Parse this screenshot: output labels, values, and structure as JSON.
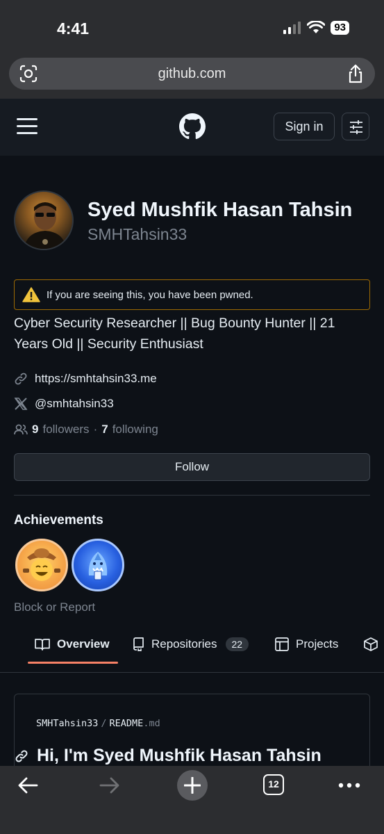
{
  "status_bar": {
    "time": "4:41",
    "battery": "93"
  },
  "browser": {
    "url": "github.com",
    "tabs_count": "12"
  },
  "header": {
    "sign_in_label": "Sign in"
  },
  "profile": {
    "full_name": "Syed Mushfik Hasan Tahsin",
    "username": "SMHTahsin33",
    "warning": "If you are seeing this, you have been pwned.",
    "bio": "Cyber Security Researcher || Bug Bounty Hunter || 21 Years Old || Security Enthusiast",
    "website": "https://smhtahsin33.me",
    "x_handle": "@smhtahsin33",
    "followers_count": "9",
    "followers_label": "followers",
    "separator": "·",
    "following_count": "7",
    "following_label": "following",
    "follow_button": "Follow",
    "achievements_title": "Achievements",
    "block_report": "Block or Report"
  },
  "tabs": [
    {
      "label": "Overview",
      "icon": "book-icon"
    },
    {
      "label": "Repositories",
      "icon": "repo-icon",
      "count": "22"
    },
    {
      "label": "Projects",
      "icon": "table-icon"
    },
    {
      "label": "",
      "icon": "package-icon"
    }
  ],
  "readme": {
    "owner": "SMHTahsin33",
    "slash": "/",
    "file": "README",
    "ext": ".md",
    "heading": "Hi, I'm Syed Mushfik Hasan Tahsin"
  },
  "colors": {
    "background": "#0d1117",
    "header": "#161b22",
    "border": "#30363d",
    "muted": "#7d8590",
    "warning_border": "#9e6a03",
    "tab_underline": "#f78166"
  }
}
